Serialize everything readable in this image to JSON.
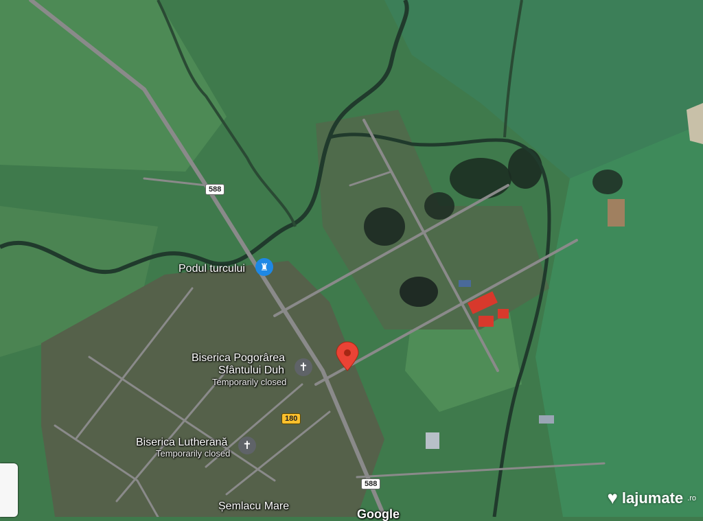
{
  "map": {
    "places": [
      {
        "name": "Podul turcului",
        "note": ""
      },
      {
        "name": "Biserica Pogorârea",
        "name2": "Sfântului Duh",
        "note": "Temporarily closed"
      },
      {
        "name": "Biserica Lutherană",
        "note": "Temporarily closed"
      }
    ],
    "town": "Șemlacu Mare",
    "road_shields": [
      "588",
      "588",
      "180"
    ],
    "attribution": "Google",
    "icons": {
      "bridge": "bridge-icon",
      "church": "cross-icon",
      "pin": "map-pin-icon"
    }
  },
  "watermark": {
    "brand": "lajumate",
    "suffix": ".ro"
  },
  "colors": {
    "pin": "#ea4335",
    "bridge_marker": "#1e88e5",
    "church_marker": "#5f6368",
    "road": "#8a8a8a",
    "road_shield": "#fbc02d"
  }
}
